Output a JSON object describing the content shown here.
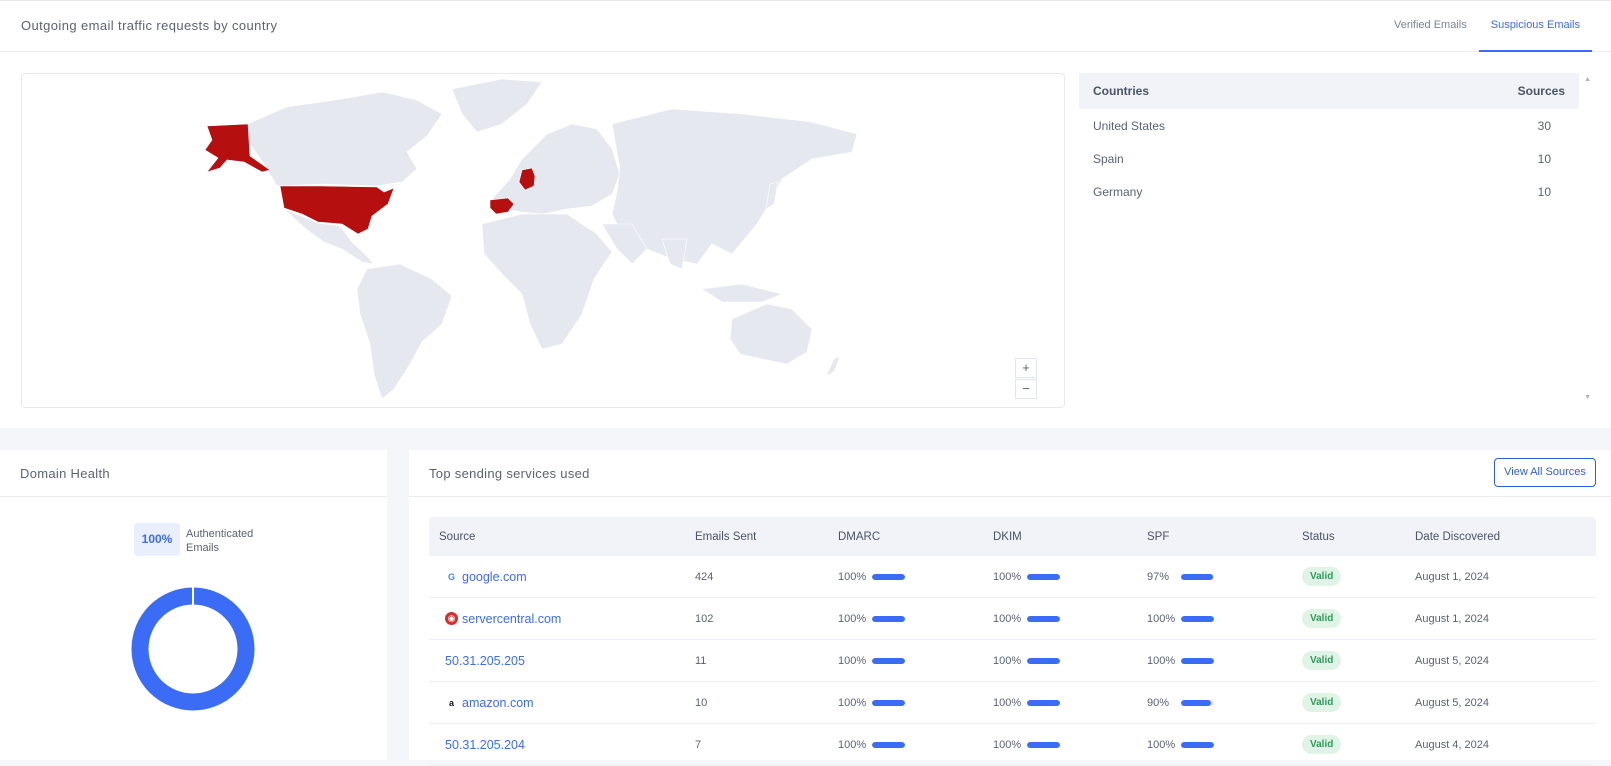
{
  "traffic": {
    "title": "Outgoing email traffic requests by country",
    "tabs": [
      {
        "label": "Verified Emails",
        "active": false
      },
      {
        "label": "Suspicious Emails",
        "active": true
      }
    ],
    "map": {
      "base_color": "#e6e8f0",
      "highlight_color": "#b50f0f",
      "highlighted_countries": [
        "United States",
        "Spain",
        "Germany"
      ],
      "zoom_in": "+",
      "zoom_out": "−"
    },
    "table": {
      "headers": {
        "country": "Countries",
        "sources": "Sources"
      },
      "rows": [
        {
          "country": "United States",
          "sources": "30"
        },
        {
          "country": "Spain",
          "sources": "10"
        },
        {
          "country": "Germany",
          "sources": "10"
        }
      ]
    }
  },
  "domain_health": {
    "title": "Domain Health",
    "authenticated_percent": "100%",
    "authenticated_label": "Authenticated Emails",
    "donut_fraction": 1.0,
    "donut_color": "#3b6cf6"
  },
  "services": {
    "title": "Top sending services used",
    "view_all_label": "View All Sources",
    "headers": {
      "source": "Source",
      "emails_sent": "Emails Sent",
      "dmarc": "DMARC",
      "dkim": "DKIM",
      "spf": "SPF",
      "status": "Status",
      "date": "Date Discovered"
    },
    "rows": [
      {
        "source": "google.com",
        "icon": "google-icon",
        "emails_sent": "424",
        "dmarc": "100%",
        "dmarc_v": 100,
        "dkim": "100%",
        "dkim_v": 100,
        "spf": "97%",
        "spf_v": 97,
        "status": "Valid",
        "date": "August 1, 2024"
      },
      {
        "source": "servercentral.com",
        "icon": "servercentral-icon",
        "emails_sent": "102",
        "dmarc": "100%",
        "dmarc_v": 100,
        "dkim": "100%",
        "dkim_v": 100,
        "spf": "100%",
        "spf_v": 100,
        "status": "Valid",
        "date": "August 1, 2024"
      },
      {
        "source": "50.31.205.205",
        "icon": "",
        "emails_sent": "11",
        "dmarc": "100%",
        "dmarc_v": 100,
        "dkim": "100%",
        "dkim_v": 100,
        "spf": "100%",
        "spf_v": 100,
        "status": "Valid",
        "date": "August 5, 2024"
      },
      {
        "source": "amazon.com",
        "icon": "amazon-icon",
        "emails_sent": "10",
        "dmarc": "100%",
        "dmarc_v": 100,
        "dkim": "100%",
        "dkim_v": 100,
        "spf": "90%",
        "spf_v": 90,
        "status": "Valid",
        "date": "August 5, 2024"
      },
      {
        "source": "50.31.205.204",
        "icon": "",
        "emails_sent": "7",
        "dmarc": "100%",
        "dmarc_v": 100,
        "dkim": "100%",
        "dkim_v": 100,
        "spf": "100%",
        "spf_v": 100,
        "status": "Valid",
        "date": "August 4, 2024"
      }
    ]
  }
}
